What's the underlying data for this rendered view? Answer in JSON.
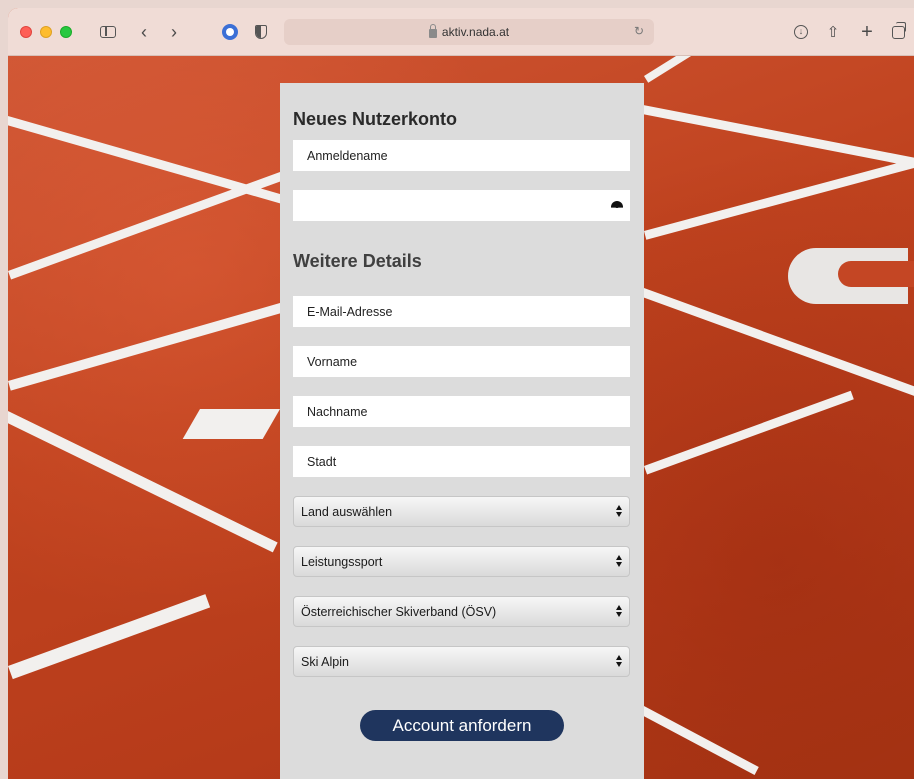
{
  "browser": {
    "url": "aktiv.nada.at",
    "icons": [
      "sidebar-icon",
      "back-icon",
      "forward-icon",
      "password-manager-icon",
      "privacy-shield-icon",
      "lock-icon",
      "reload-icon",
      "download-icon",
      "share-icon",
      "new-tab-icon",
      "tab-overview-icon"
    ],
    "glyphs": {
      "back": "‹",
      "forward": "›",
      "reload": "↻",
      "download": "↓",
      "share": "⇧",
      "plus": "+"
    }
  },
  "form": {
    "title": "Neues Nutzerkonto",
    "username_placeholder": "Anmeldename",
    "password_value": "",
    "details_title": "Weitere Details",
    "email_placeholder": "E-Mail-Adresse",
    "firstname_placeholder": "Vorname",
    "lastname_placeholder": "Nachname",
    "city_placeholder": "Stadt",
    "country_select": "Land auswählen",
    "sport_type_select": "Leistungssport",
    "federation_select": "Österreichischer Skiverband (ÖSV)",
    "discipline_select": "Ski Alpin",
    "submit_label": "Account anfordern"
  },
  "colors": {
    "track": "#c84a26",
    "card": "#dcdcdc",
    "button": "#1f355e"
  }
}
